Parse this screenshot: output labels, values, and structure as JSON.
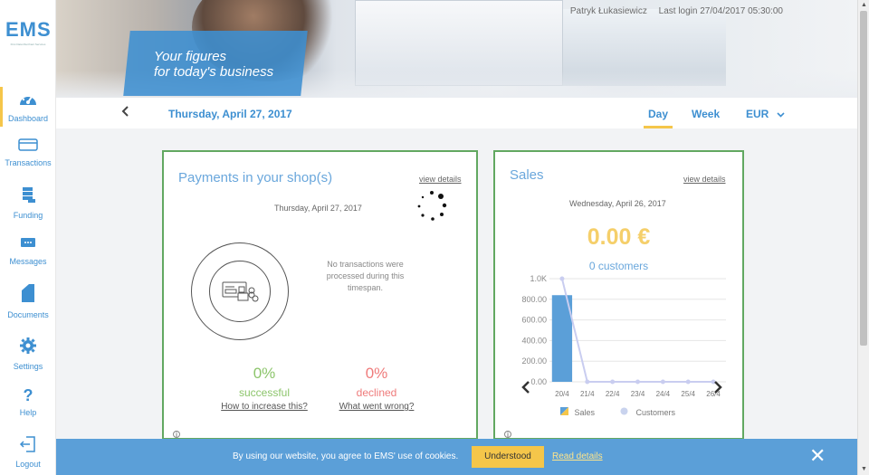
{
  "app": {
    "logo": "EMS",
    "logo_tagline": "First Data Merchant Services"
  },
  "sidebar": {
    "items": [
      {
        "label": "Dashboard",
        "icon": "dashboard-gauge-icon",
        "active": true
      },
      {
        "label": "Transactions",
        "icon": "card-icon"
      },
      {
        "label": "Funding",
        "icon": "coins-stack-icon"
      },
      {
        "label": "Messages",
        "icon": "chat-bubble-icon"
      },
      {
        "label": "Documents",
        "icon": "document-icon"
      },
      {
        "label": "Settings",
        "icon": "gear-icon"
      },
      {
        "label": "Help",
        "icon": "question-icon"
      },
      {
        "label": "Logout",
        "icon": "logout-icon"
      }
    ]
  },
  "header": {
    "user_name": "Patryk Łukasiewicz",
    "last_login": "Last login 27/04/2017 05:30:00",
    "slogan_line1": "Your figures",
    "slogan_line2": "for today's business"
  },
  "datebar": {
    "current_date": "Thursday, April 27, 2017",
    "tab_day": "Day",
    "tab_week": "Week",
    "currency": "EUR"
  },
  "payments": {
    "title": "Payments in your shop(s)",
    "view_details": "view details",
    "date": "Thursday, April 27, 2017",
    "no_transactions": "No transactions were processed during this timespan.",
    "successful_pct": "0%",
    "successful_label": "successful",
    "successful_link": "How to increase this?",
    "declined_pct": "0%",
    "declined_label": "declined",
    "declined_link": "What went wrong?"
  },
  "sales": {
    "title": "Sales",
    "view_details": "view details",
    "date": "Wednesday, April 26, 2017",
    "amount": "0.00 €",
    "customers": "0 customers",
    "legend_sales": "Sales",
    "legend_customers": "Customers"
  },
  "chart_data": {
    "type": "bar",
    "categories": [
      "20/4",
      "21/4",
      "22/4",
      "23/4",
      "24/4",
      "25/4",
      "26/4"
    ],
    "y_tick_labels": [
      "0.00",
      "200.00",
      "400.00",
      "600.00",
      "800.00",
      "1.0K"
    ],
    "series": [
      {
        "name": "Sales",
        "type": "bar",
        "values": [
          840,
          0,
          0,
          0,
          0,
          0,
          0
        ],
        "color": "#5b9fd8"
      },
      {
        "name": "Customers",
        "type": "line",
        "values": [
          1000,
          0,
          0,
          0,
          0,
          0,
          0
        ],
        "color": "#c9cdf0"
      }
    ],
    "ylim": [
      0,
      1000
    ],
    "grid": true,
    "legend": "bottom"
  },
  "cookie": {
    "message": "By using our website, you agree to EMS' use of cookies.",
    "button": "Understood",
    "link": "Read details"
  },
  "colors": {
    "accent": "#3d8fd1",
    "highlight": "#f5c64a",
    "card_border": "#62a861"
  }
}
